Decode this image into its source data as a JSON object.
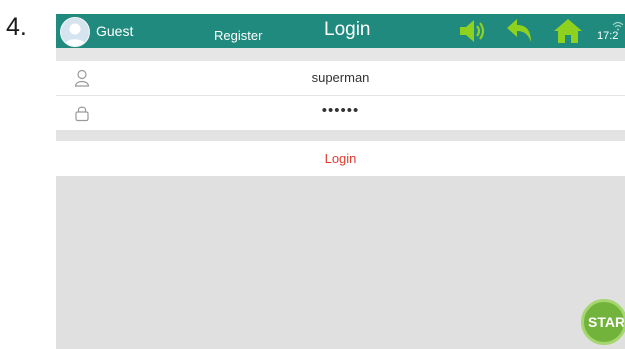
{
  "step": {
    "number": "4."
  },
  "topbar": {
    "guest_label": "Guest",
    "register_label": "Register",
    "title": "Login",
    "clock": "17:2",
    "accent_color": "#1f8a7d",
    "icon_color": "#8ed11f"
  },
  "form": {
    "username_value": "superman",
    "password_value": "••••••",
    "login_label": "Login"
  },
  "start_button": {
    "label": "STAR"
  }
}
